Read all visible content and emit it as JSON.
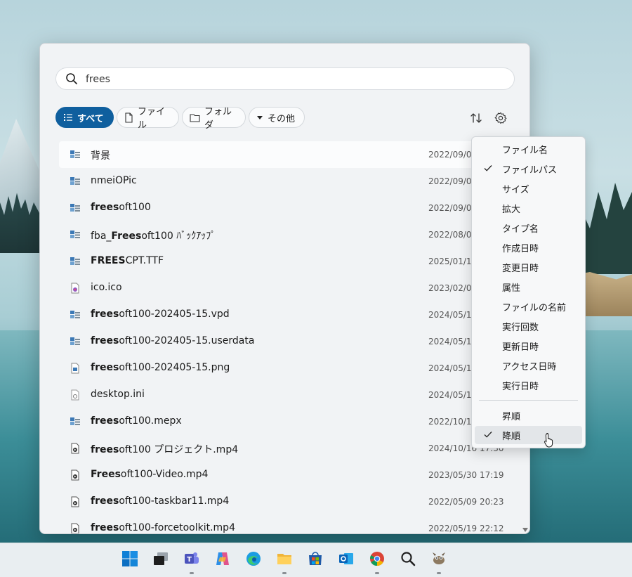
{
  "search": {
    "value": "frees",
    "placeholder": ""
  },
  "filters": {
    "all": "すべて",
    "file": "ファイル",
    "folder": "フォルダ",
    "other": "その他"
  },
  "files": [
    {
      "pre": "",
      "bold": "",
      "post": "背景",
      "date": "2022/09/0",
      "icon": "app-icon"
    },
    {
      "pre": "",
      "bold": "",
      "post": "nmeiOPic",
      "date": "2022/09/0",
      "icon": "app-icon"
    },
    {
      "pre": "",
      "bold": "frees",
      "post": "oft100",
      "date": "2022/09/0",
      "icon": "app-icon"
    },
    {
      "pre": "fba_",
      "bold": "Frees",
      "post": "oft100 ﾊﾞｯｸｱｯﾌﾟ",
      "date": "2022/08/0",
      "icon": "app-icon"
    },
    {
      "pre": "",
      "bold": "FREES",
      "post": "CPT.TTF",
      "date": "2025/01/1",
      "icon": "app-icon"
    },
    {
      "pre": "",
      "bold": "",
      "post": "ico.ico",
      "date": "2023/02/0",
      "icon": "image-file-icon"
    },
    {
      "pre": "",
      "bold": "frees",
      "post": "oft100-202405-15.vpd",
      "date": "2024/05/1",
      "icon": "app-icon"
    },
    {
      "pre": "",
      "bold": "frees",
      "post": "oft100-202405-15.userdata",
      "date": "2024/05/1",
      "icon": "app-icon"
    },
    {
      "pre": "",
      "bold": "frees",
      "post": "oft100-202405-15.png",
      "date": "2024/05/1",
      "icon": "png-file-icon"
    },
    {
      "pre": "",
      "bold": "",
      "post": "desktop.ini",
      "date": "2024/05/1",
      "icon": "settings-file-icon"
    },
    {
      "pre": "",
      "bold": "frees",
      "post": "oft100.mepx",
      "date": "2022/10/1",
      "icon": "app-icon"
    },
    {
      "pre": "",
      "bold": "frees",
      "post": "oft100 プロジェクト.mp4",
      "date": "2024/10/16 17:30",
      "icon": "video-file-icon"
    },
    {
      "pre": "",
      "bold": "Frees",
      "post": "oft100-Video.mp4",
      "date": "2023/05/30 17:19",
      "icon": "video-file-icon"
    },
    {
      "pre": "",
      "bold": "frees",
      "post": "oft100-taskbar11.mp4",
      "date": "2022/05/09 20:23",
      "icon": "video-file-icon"
    },
    {
      "pre": "",
      "bold": "frees",
      "post": "oft100-forcetoolkit.mp4",
      "date": "2022/05/19 22:12",
      "icon": "video-file-icon"
    }
  ],
  "sort_menu": {
    "fields": [
      "ファイル名",
      "ファイルパス",
      "サイズ",
      "拡大",
      "タイプ名",
      "作成日時",
      "変更日時",
      "属性",
      "ファイルの名前",
      "実行回数",
      "更新日時",
      "アクセス日時",
      "実行日時"
    ],
    "checked_field": "ファイルパス",
    "orders": [
      "昇順",
      "降順"
    ],
    "checked_order": "降順"
  },
  "colors": {
    "accent": "#0f5f9e"
  },
  "taskbar": [
    "windows-start-icon",
    "task-view-icon",
    "teams-icon",
    "copilot-icon",
    "edge-icon",
    "file-explorer-icon",
    "store-icon",
    "outlook-icon",
    "chrome-icon",
    "search-app-icon",
    "gimp-icon"
  ]
}
